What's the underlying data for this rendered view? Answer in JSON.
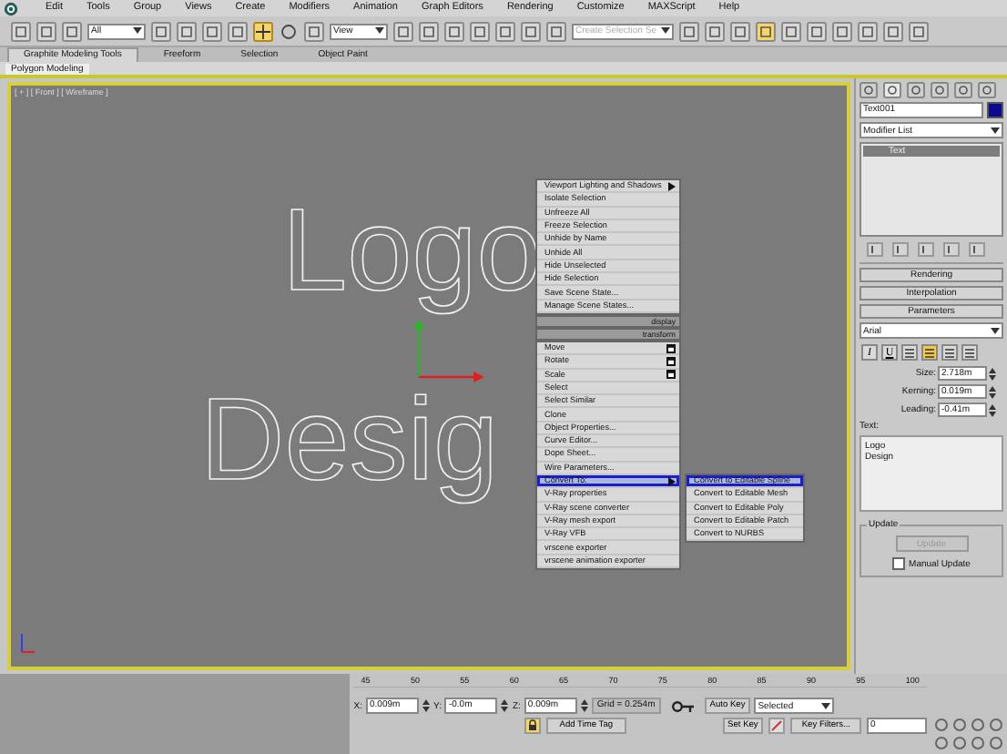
{
  "menu_bar": {
    "items": [
      "Edit",
      "Tools",
      "Group",
      "Views",
      "Create",
      "Modifiers",
      "Animation",
      "Graph Editors",
      "Rendering",
      "Customize",
      "MAXScript",
      "Help"
    ]
  },
  "toolbar": {
    "selection_filter": "All",
    "reference_coordinate": "View",
    "named_selection": "Create Selection Se"
  },
  "ribbon": {
    "tabs": [
      {
        "label": "Graphite Modeling Tools",
        "selected": true
      },
      {
        "label": "Freeform",
        "selected": false
      },
      {
        "label": "Selection",
        "selected": false
      },
      {
        "label": "Object Paint",
        "selected": false
      }
    ],
    "panel": "Polygon Modeling"
  },
  "viewport": {
    "label": "[ + ] [ Front ] [ Wireframe ]",
    "text_lines": [
      "Logo",
      "Desig"
    ]
  },
  "quad_menu": {
    "display": {
      "header": "display",
      "items": [
        {
          "label": "Viewport Lighting and Shadows",
          "kind": "submenu"
        },
        {
          "label": "Isolate Selection",
          "kind": "plain"
        },
        {
          "label": "Unfreeze All",
          "kind": "plain"
        },
        {
          "label": "Freeze Selection",
          "kind": "plain"
        },
        {
          "label": "Unhide by Name",
          "kind": "plain"
        },
        {
          "label": "Unhide All",
          "kind": "plain"
        },
        {
          "label": "Hide Unselected",
          "kind": "plain"
        },
        {
          "label": "Hide Selection",
          "kind": "plain"
        },
        {
          "label": "Save Scene State...",
          "kind": "plain"
        },
        {
          "label": "Manage Scene States...",
          "kind": "plain"
        }
      ]
    },
    "transform": {
      "header": "transform",
      "items": [
        {
          "label": "Move",
          "kind": "settings",
          "selected": false
        },
        {
          "label": "Rotate",
          "kind": "settings",
          "selected": false
        },
        {
          "label": "Scale",
          "kind": "settings",
          "selected": false
        },
        {
          "label": "Select",
          "kind": "plain",
          "selected": false
        },
        {
          "label": "Select Similar",
          "kind": "plain",
          "selected": false
        },
        {
          "label": "Clone",
          "kind": "plain",
          "selected": false
        },
        {
          "label": "Object Properties...",
          "kind": "plain",
          "selected": false
        },
        {
          "label": "Curve Editor...",
          "kind": "plain",
          "selected": false
        },
        {
          "label": "Dope Sheet...",
          "kind": "plain",
          "selected": false
        },
        {
          "label": "Wire Parameters...",
          "kind": "plain",
          "selected": false
        },
        {
          "label": "Convert To:",
          "kind": "submenu",
          "selected": true
        },
        {
          "label": "V-Ray properties",
          "kind": "plain",
          "selected": false
        },
        {
          "label": "V-Ray scene converter",
          "kind": "plain",
          "selected": false
        },
        {
          "label": "V-Ray mesh export",
          "kind": "plain",
          "selected": false
        },
        {
          "label": "V-Ray VFB",
          "kind": "plain",
          "selected": false
        },
        {
          "label": "vrscene exporter",
          "kind": "plain",
          "selected": false
        },
        {
          "label": "vrscene animation exporter",
          "kind": "plain",
          "selected": false
        }
      ]
    },
    "submenu": {
      "items": [
        {
          "label": "Convert to Editable Spline",
          "selected": true
        },
        {
          "label": "Convert to Editable Mesh",
          "selected": false
        },
        {
          "label": "Convert to Editable Poly",
          "selected": false
        },
        {
          "label": "Convert to Editable Patch",
          "selected": false
        },
        {
          "label": "Convert to NURBS",
          "selected": false
        }
      ]
    }
  },
  "command_panel": {
    "object_name": "Text001",
    "modifier_list": "Modifier List",
    "stack": [
      "Text"
    ],
    "rollouts": [
      "Rendering",
      "Interpolation",
      "Parameters"
    ],
    "font": "Arial",
    "style_buttons": [
      {
        "label": "I",
        "selected": false
      },
      {
        "label": "U",
        "selected": false
      }
    ],
    "align_buttons": [
      {
        "selected": false
      },
      {
        "selected": true
      },
      {
        "selected": false
      },
      {
        "selected": false
      }
    ],
    "spinners": [
      {
        "label": "Size:",
        "value": "2.718m"
      },
      {
        "label": "Kerning:",
        "value": "0.019m"
      },
      {
        "label": "Leading:",
        "value": "-0.41m"
      }
    ],
    "text_label": "Text:",
    "text_value": "Logo\nDesign",
    "update_group": "Update",
    "update_button": {
      "label": "Update",
      "disabled": true
    },
    "manual_update": {
      "label": "Manual Update",
      "checked": false
    }
  },
  "timeline": {
    "ticks": [
      "45",
      "50",
      "55",
      "60",
      "65",
      "70",
      "75",
      "80",
      "85",
      "90",
      "95",
      "100"
    ]
  },
  "status": {
    "x_label": "X:",
    "x": "0.009m",
    "y_label": "Y:",
    "y": "-0.0m",
    "z_label": "Z:",
    "z": "0.009m",
    "grid": "Grid = 0.254m",
    "add_time_tag": "Add Time Tag",
    "auto_key": "Auto Key",
    "key_mode": "Selected",
    "set_key": "Set Key",
    "key_filters": "Key Filters...",
    "frame": "0"
  }
}
